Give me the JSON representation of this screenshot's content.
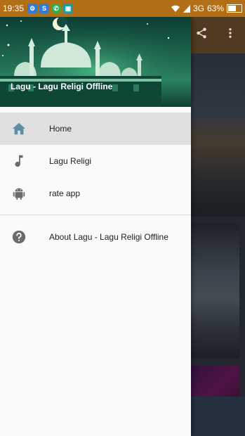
{
  "status_bar": {
    "time": "19:35",
    "network": "3G",
    "battery": "63%",
    "battery_level": 0.63
  },
  "drawer": {
    "header_title": "Lagu - Lagu Religi Offline",
    "items": [
      {
        "label": "Home",
        "icon": "home-icon",
        "active": true
      },
      {
        "label": "Lagu Religi",
        "icon": "music-note-icon",
        "active": false
      },
      {
        "label": "rate app",
        "icon": "android-icon",
        "active": false
      }
    ],
    "secondary_items": [
      {
        "label": "About Lagu - Lagu Religi Offline",
        "icon": "help-icon"
      }
    ]
  },
  "toolbar": {
    "icons": [
      "share-icon",
      "more-vert-icon"
    ]
  },
  "colors": {
    "status_bar": "#b26f16",
    "drawer_bg": "#fafafa",
    "active_item_bg": "#e0e0e0",
    "home_icon": "#5b8fa3",
    "icon_gray": "#6b6b6b"
  }
}
